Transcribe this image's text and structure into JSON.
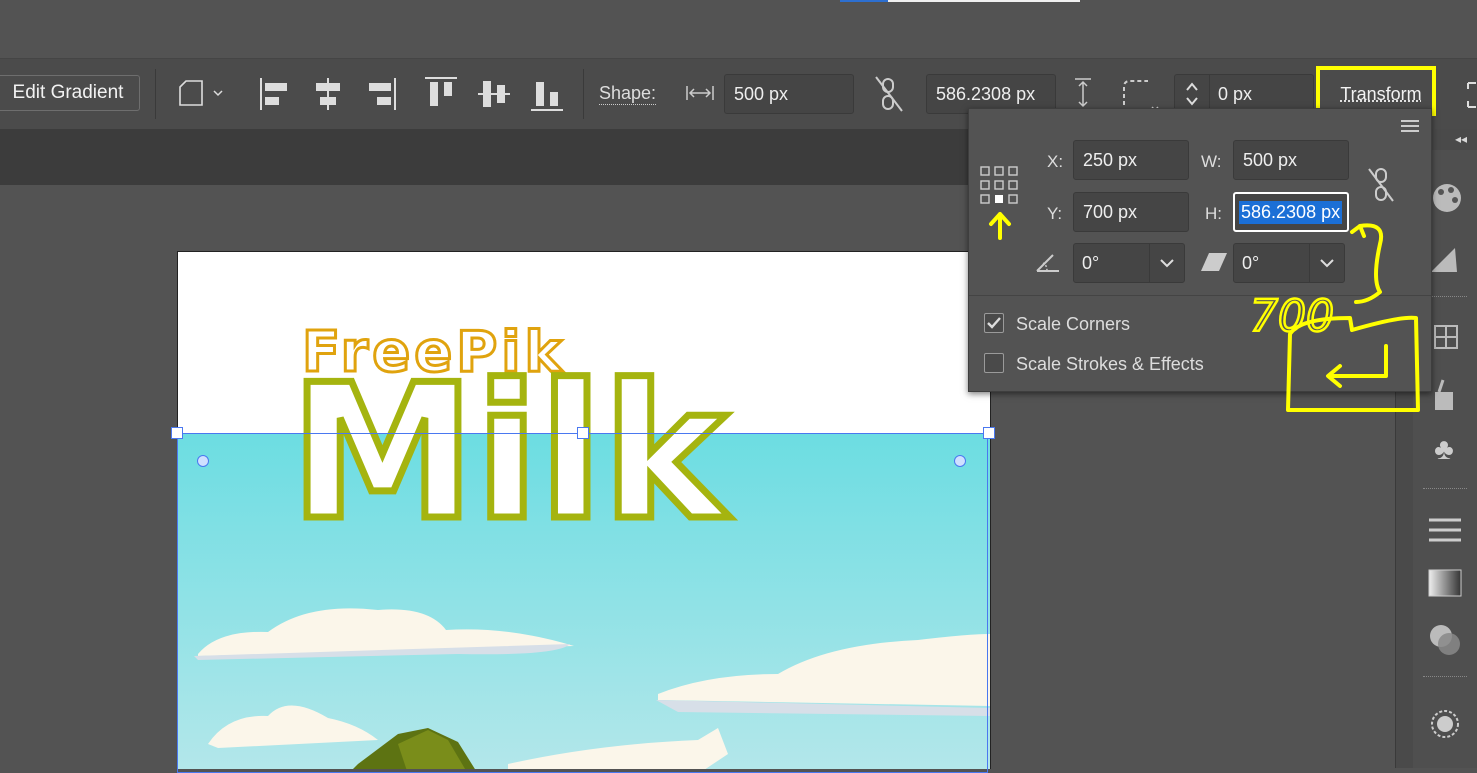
{
  "toolbar": {
    "edit_gradient_label": "Edit Gradient",
    "shape_label": "Shape:",
    "width_value": "500 px",
    "height_value": "586.2308 px",
    "corner_value": "0 px",
    "transform_label": "Transform"
  },
  "transform_panel": {
    "x_label": "X:",
    "x_value": "250 px",
    "y_label": "Y:",
    "y_value": "700 px",
    "w_label": "W:",
    "w_value": "500 px",
    "h_label": "H:",
    "h_value": "586.2308 px",
    "angle_value": "0°",
    "shear_value": "0°",
    "scale_corners_label": "Scale Corners",
    "scale_corners_checked": true,
    "scale_strokes_label": "Scale Strokes & Effects",
    "scale_strokes_checked": false
  },
  "artwork": {
    "brand_text": "FreePik",
    "product_text": "Milk",
    "brand_color": "#e0a30e",
    "product_outline_color": "#a5b40f",
    "sky_color": "#7adfe2"
  },
  "annotations": {
    "handwritten_value": "700",
    "highlight_color": "#ffff00"
  },
  "colors": {
    "selection_blue": "#4a78f0",
    "input_highlight": "#1b6fd6"
  }
}
